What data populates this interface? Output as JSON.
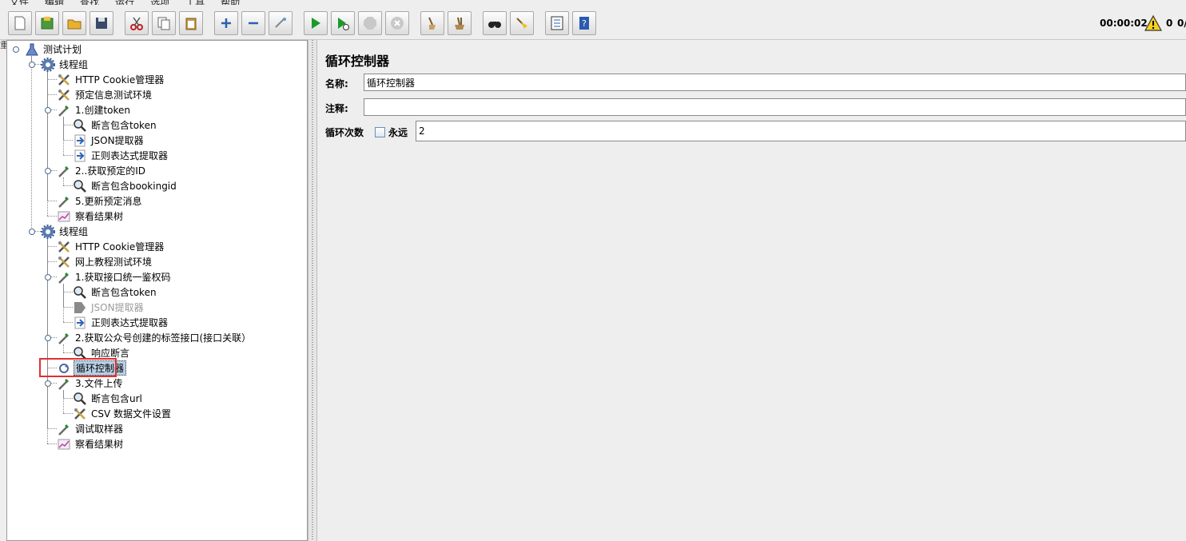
{
  "toolbar": {
    "timer": "00:00:02",
    "warning_count": "0",
    "thread_count": "0/"
  },
  "tree": {
    "nodes": [
      {
        "label": "测试计划",
        "icon": "test-plan-icon"
      },
      {
        "label": "线程组",
        "icon": "gear-icon"
      },
      {
        "label": "HTTP Cookie管理器",
        "icon": "config-tools-icon"
      },
      {
        "label": "预定信息测试环境",
        "icon": "config-tools-icon"
      },
      {
        "label": "1.创建token",
        "icon": "sampler-pipette-icon"
      },
      {
        "label": "断言包含token",
        "icon": "magnifier-icon"
      },
      {
        "label": "JSON提取器",
        "icon": "extractor-arrow-icon"
      },
      {
        "label": "正则表达式提取器",
        "icon": "extractor-arrow-icon"
      },
      {
        "label": "2..获取预定的ID",
        "icon": "sampler-pipette-icon"
      },
      {
        "label": "断言包含bookingid",
        "icon": "magnifier-icon"
      },
      {
        "label": "5.更新预定消息",
        "icon": "sampler-pipette-icon"
      },
      {
        "label": "察看结果树",
        "icon": "listener-chart-icon"
      },
      {
        "label": "线程组",
        "icon": "gear-icon"
      },
      {
        "label": "HTTP Cookie管理器",
        "icon": "config-tools-icon"
      },
      {
        "label": "网上教程测试环境",
        "icon": "config-tools-icon"
      },
      {
        "label": "1.获取接口统一鉴权码",
        "icon": "sampler-pipette-icon"
      },
      {
        "label": "断言包含token",
        "icon": "magnifier-icon"
      },
      {
        "label": "JSON提取器",
        "icon": "extractor-disabled-icon"
      },
      {
        "label": "正则表达式提取器",
        "icon": "extractor-arrow-icon"
      },
      {
        "label": "2.获取公众号创建的标签接口(接口关联）",
        "icon": "sampler-pipette-icon"
      },
      {
        "label": "响应断言",
        "icon": "magnifier-icon"
      },
      {
        "label": "循环控制器",
        "icon": "loop-controller-icon"
      },
      {
        "label": "3.文件上传",
        "icon": "sampler-pipette-icon"
      },
      {
        "label": "断言包含url",
        "icon": "magnifier-icon"
      },
      {
        "label": "CSV 数据文件设置",
        "icon": "config-tools-icon"
      },
      {
        "label": "调试取样器",
        "icon": "sampler-pipette-icon"
      },
      {
        "label": "察看结果树",
        "icon": "listener-chart-icon"
      }
    ]
  },
  "panel": {
    "title": "循环控制器",
    "name_label": "名称:",
    "name_value": "循环控制器",
    "comment_label": "注释:",
    "comment_value": "",
    "loop_label": "循环次数",
    "forever_label": "永远",
    "loop_value": "2"
  },
  "colors": {
    "accent_highlight": "#e03030",
    "selection": "#b8cfe5"
  }
}
